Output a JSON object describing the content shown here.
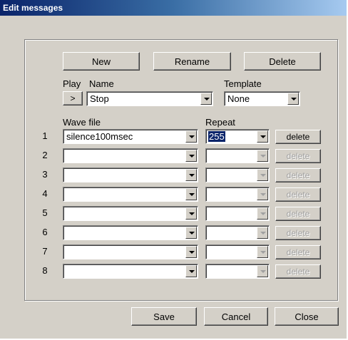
{
  "window": {
    "title": "Edit messages"
  },
  "toolbar": {
    "new_label": "New",
    "rename_label": "Rename",
    "delete_label": "Delete"
  },
  "message": {
    "play_label": "Play",
    "play_button_label": ">",
    "name_label": "Name",
    "name_value": "Stop",
    "template_label": "Template",
    "template_value": "None"
  },
  "table": {
    "wave_header": "Wave file",
    "repeat_header": "Repeat",
    "rows": [
      {
        "num": "1",
        "wave": "silence100msec",
        "repeat": "255",
        "delete": "delete"
      },
      {
        "num": "2",
        "wave": "",
        "repeat": "",
        "delete": "delete"
      },
      {
        "num": "3",
        "wave": "",
        "repeat": "",
        "delete": "delete"
      },
      {
        "num": "4",
        "wave": "",
        "repeat": "",
        "delete": "delete"
      },
      {
        "num": "5",
        "wave": "",
        "repeat": "",
        "delete": "delete"
      },
      {
        "num": "6",
        "wave": "",
        "repeat": "",
        "delete": "delete"
      },
      {
        "num": "7",
        "wave": "",
        "repeat": "",
        "delete": "delete"
      },
      {
        "num": "8",
        "wave": "",
        "repeat": "",
        "delete": "delete"
      }
    ]
  },
  "footer": {
    "save_label": "Save",
    "cancel_label": "Cancel",
    "close_label": "Close"
  }
}
